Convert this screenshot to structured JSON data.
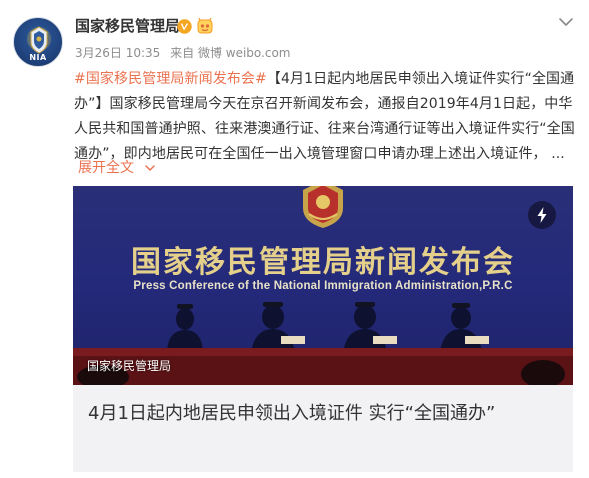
{
  "post": {
    "author": "国家移民管理局",
    "avatar_text": "NIA",
    "date": "3月26日 10:35",
    "source": "来自 微博 weibo.com",
    "topic": "#国家移民管理局新闻发布会#",
    "body": "【4月1日起内地居民申领出入境证件实行“全国通办”】国家移民管理局今天在京召开新闻发布会，通报自2019年4月1日起，中华人民共和国普通护照、往来港澳通行证、往来台湾通行证等出入境证件实行“全国通办”，即内地居民可在全国任一出入境管理窗口申请办理上述出入境证件，  ...",
    "expand_label": "展开全文"
  },
  "card": {
    "banner_cn": "国家移民管理局新闻发布会",
    "banner_en": "Press Conference of the National Immigration Administration,P.R.C",
    "watermark": "国家移民管理局",
    "title": "4月1日起内地居民申领出入境证件 实行“全国通办”"
  },
  "icons": {
    "verified": "verified-v-icon",
    "member": "vip-member-icon",
    "more": "chevron-down-icon",
    "expand": "chevron-down-icon",
    "media": "lightning-icon"
  },
  "colors": {
    "accent": "#eb7350",
    "verified": "#f5a623",
    "banner_bg": "#24297a",
    "banner_text": "#e4d08a"
  }
}
